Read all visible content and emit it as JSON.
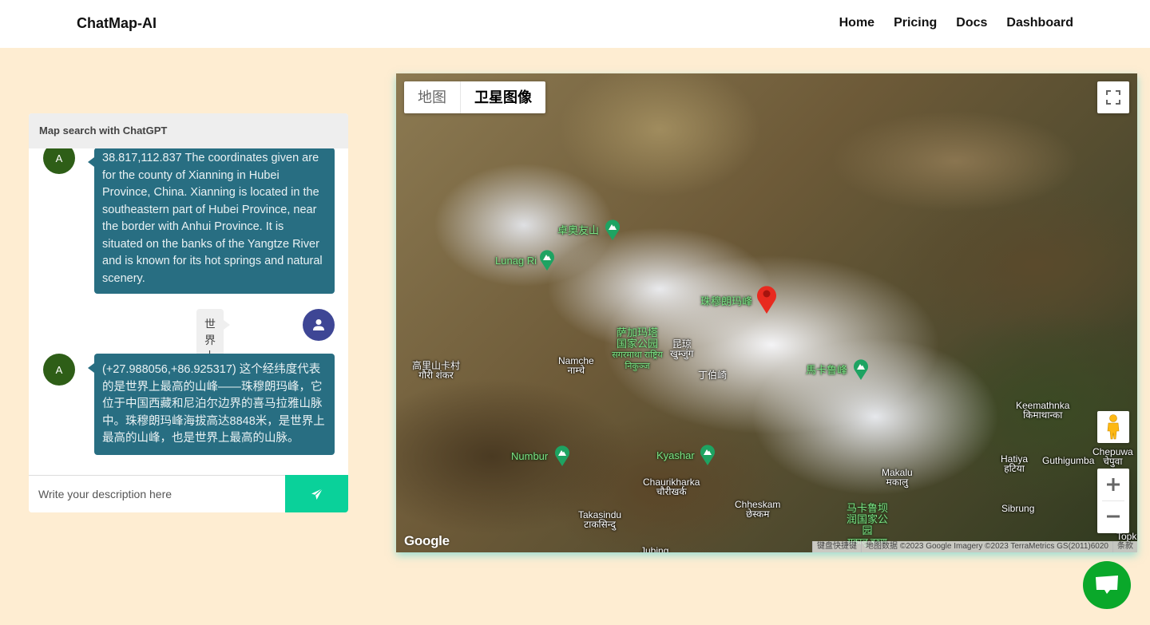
{
  "navbar": {
    "brand": "ChatMap-AI",
    "links": [
      "Home",
      "Pricing",
      "Docs",
      "Dashboard"
    ]
  },
  "chat": {
    "title": "Map search with ChatGPT",
    "messages": [
      {
        "role": "assistant",
        "avatar": "A",
        "text": "38.817,112.837 The coordinates given are for the county of Xianning in Hubei Province, China. Xianning is located in the southeastern part of Hubei Province, near the border with Anhui Province. It is situated on the banks of the Yangtze River and is known for its hot springs and natural scenery."
      },
      {
        "role": "user",
        "avatar_icon": "user-icon",
        "text": "世界上最高的山"
      },
      {
        "role": "assistant",
        "avatar": "A",
        "text": "(+27.988056,+86.925317) 这个经纬度代表的是世界上最高的山峰——珠穆朗玛峰，它位于中国西藏和尼泊尔边界的喜马拉雅山脉中。珠穆朗玛峰海拔高达8848米，是世界上最高的山峰，也是世界上最高的山脉。"
      }
    ],
    "input": {
      "value": "",
      "placeholder": "Write your description here"
    },
    "send_icon": "paper-plane-icon"
  },
  "map": {
    "type_toggle": {
      "map_label": "地图",
      "satellite_label": "卫星图像",
      "selected": "卫星图像"
    },
    "marker_label": "珠穆朗玛峰",
    "peaks": [
      "卓奥友山",
      "Lunag Ri",
      "馬卡鲁峰",
      "Numbur",
      "Kyashar"
    ],
    "places": [
      {
        "name": "高里山卡村",
        "sub": "गौरी शंकर"
      },
      {
        "name": "Namche",
        "sub": "नाम्चे"
      },
      {
        "name": "萨加玛塔国家公园",
        "sub": "सगरमाथा राष्ट्रिय निकुञ्ज"
      },
      {
        "name": "昆琼",
        "sub": "खुम्जुंग"
      },
      {
        "name": "丁伯崎",
        "sub": ""
      },
      {
        "name": "Keemathnka",
        "sub": "किमाथान्का"
      },
      {
        "name": "Chepuwa",
        "sub": "चेपुवा"
      },
      {
        "name": "Hatiya",
        "sub": "हटिया"
      },
      {
        "name": "Guthigumba",
        "sub": ""
      },
      {
        "name": "Makalu",
        "sub": "मकालु"
      },
      {
        "name": "Chaurikharka",
        "sub": "चौरीखर्क"
      },
      {
        "name": "Takasindu",
        "sub": "टाकसिन्दु"
      },
      {
        "name": "Chheskam",
        "sub": "छेस्कम"
      },
      {
        "name": "马卡鲁坝润国家公园",
        "sub": "मकालु बरुण"
      },
      {
        "name": "Sibrung",
        "sub": ""
      },
      {
        "name": "Jubing",
        "sub": ""
      },
      {
        "name": "Topke",
        "sub": ""
      }
    ],
    "logo": "Google",
    "attribution": {
      "shortcuts": "键盘快捷键",
      "data": "地图数据 ©2023 Google Imagery ©2023 TerraMetrics GS(2011)6020",
      "terms": "条款"
    },
    "controls": {
      "fullscreen": "fullscreen-icon",
      "pegman": "pegman-icon",
      "zoom_in": "+",
      "zoom_out": "−"
    }
  },
  "fab": {
    "icon": "chat-bubble-icon"
  }
}
